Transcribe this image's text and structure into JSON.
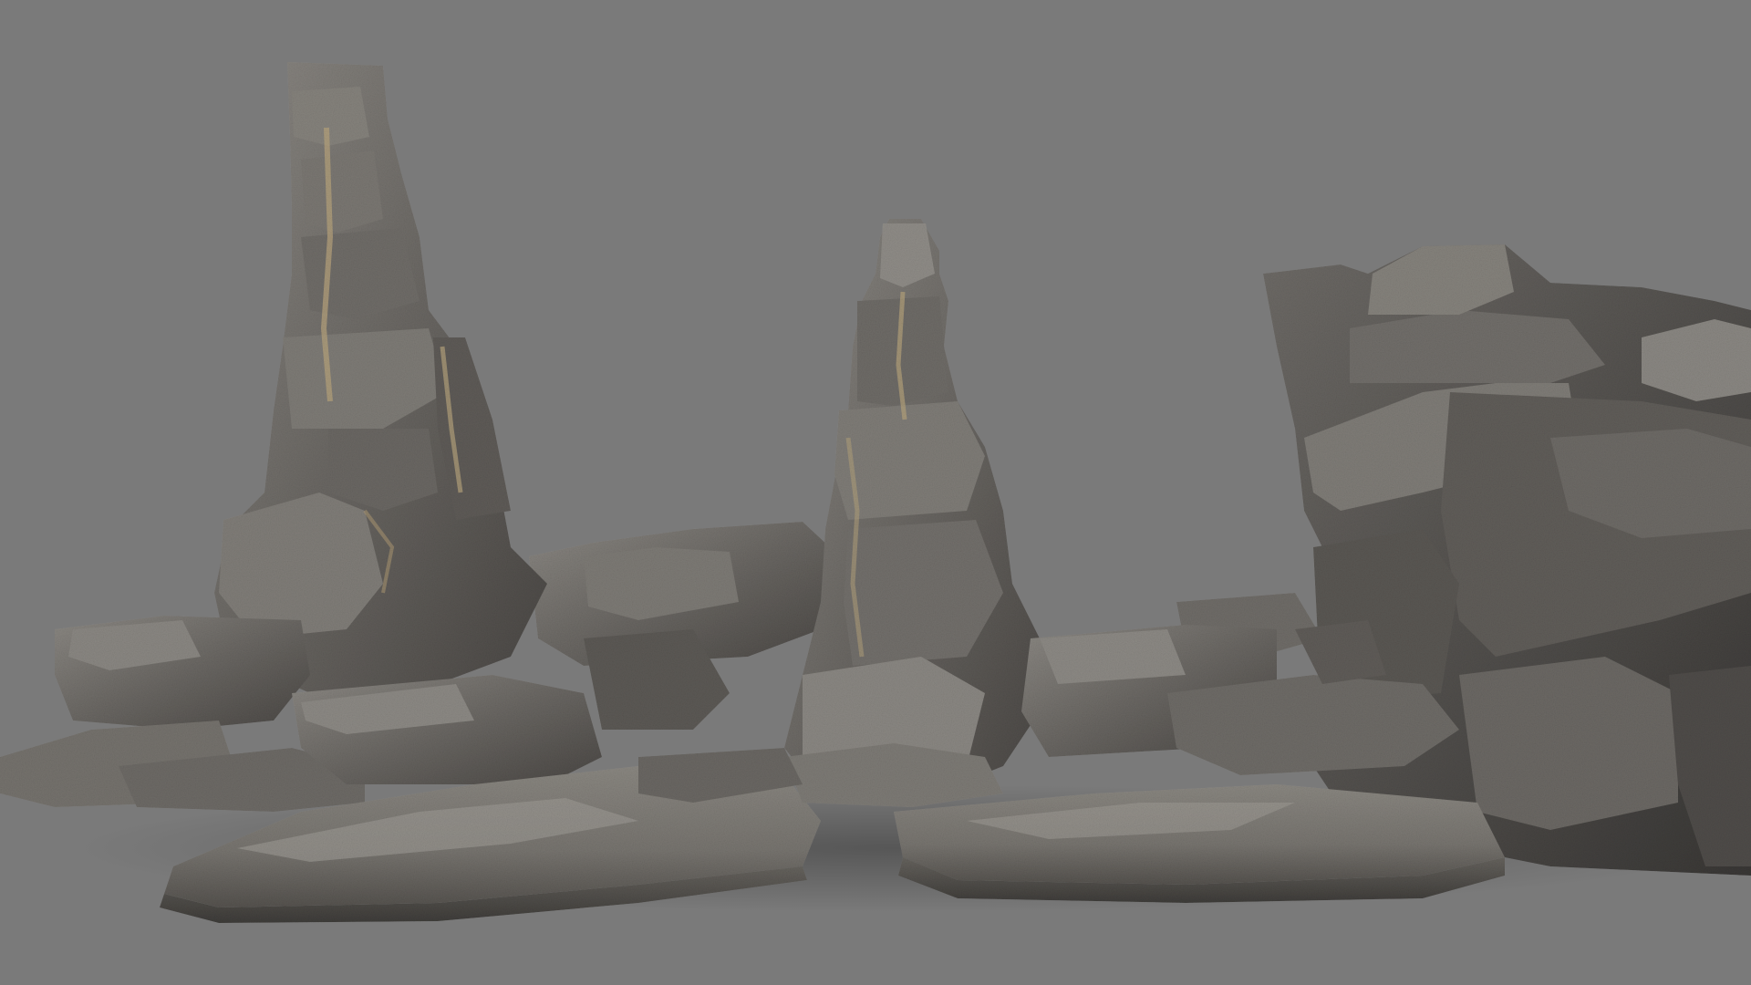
{
  "scene": {
    "background_color": "#7a7a7a",
    "subject": "rock-formation",
    "elements": [
      "tall-rock-spire-left",
      "rock-spire-center",
      "rock-cliff-right",
      "flat-rock-slabs-foreground"
    ]
  },
  "palette": {
    "stone_light": "#8f8c87",
    "stone_mid": "#6b6864",
    "stone_dark": "#45423f",
    "stone_shadow": "#2e2c2a",
    "sandy_crack": "#b5a27c"
  }
}
